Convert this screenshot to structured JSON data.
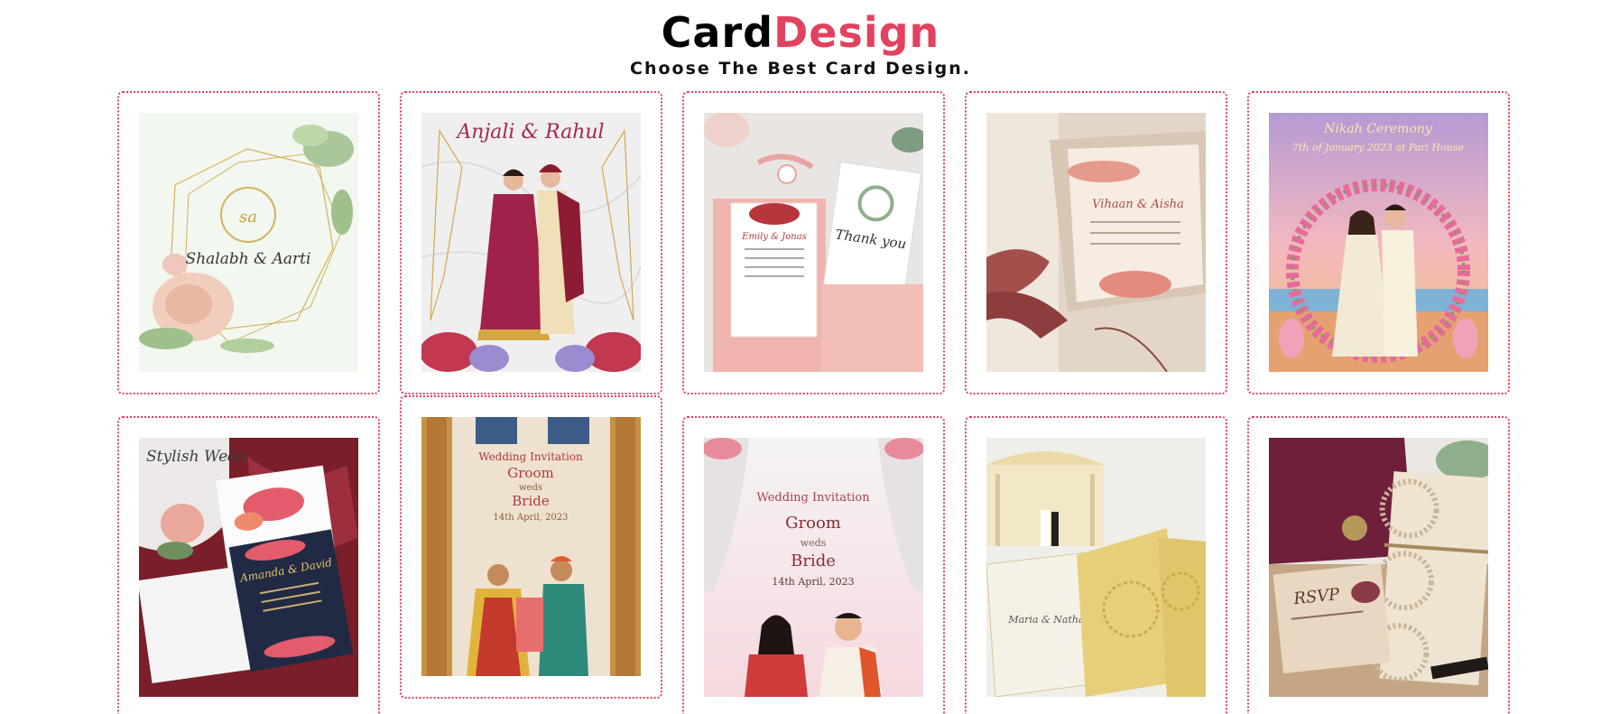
{
  "header": {
    "brand_part1": "Card",
    "brand_part2": "Design",
    "tagline": "Choose The Best Card Design."
  },
  "colors": {
    "accent": "#e2415f",
    "text": "#111111"
  },
  "cards": [
    {
      "name": "Shalabh & Aarti",
      "monogram": "sa"
    },
    {
      "name": "Anjali & Rahul"
    },
    {
      "note": "Thank you",
      "couple": "Emily & Jonas"
    },
    {
      "couple": "Vihaan & Aisha"
    },
    {
      "title": "Nikah Ceremony",
      "date_line": "7th of January 2023 at Pari House"
    },
    {
      "title": "Stylish Wedd",
      "couple": "Amanda & David"
    },
    {
      "heading": "Wedding Invitation",
      "groom": "Groom",
      "weds": "weds",
      "bride": "Bride",
      "date": "14th April, 2023"
    },
    {
      "heading": "Wedding Invitation",
      "groom": "Groom",
      "weds": "weds",
      "bride": "Bride",
      "date": "14th April, 2023"
    },
    {
      "couple": "Maria & Nathan"
    },
    {
      "rsvp": "RSVP"
    }
  ]
}
